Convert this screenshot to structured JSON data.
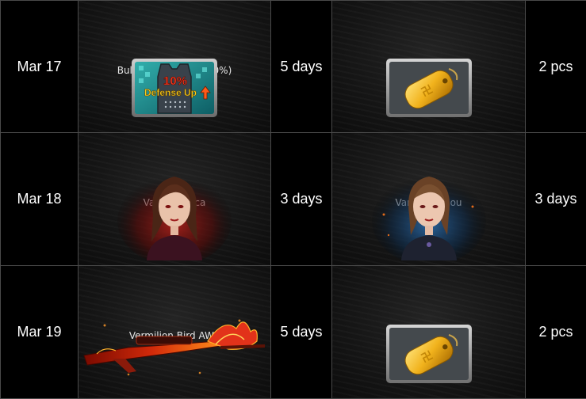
{
  "rows": [
    {
      "date": "Mar 17",
      "left_item": {
        "name": "Bullet Proof Vest+(10%)",
        "icon": "vest-icon",
        "icon_text_top": "10%",
        "icon_text_bottom": "Defense Up"
      },
      "left_duration": "5 days",
      "right_item": {
        "name": "Golden Tag",
        "icon": "golden-tag-icon"
      },
      "right_quantity": "2 pcs"
    },
    {
      "date": "Mar 18",
      "left_item": {
        "name": "Vampire Rica",
        "icon": "character-portrait"
      },
      "left_duration": "3 days",
      "right_item": {
        "name": "Vampire Chou",
        "icon": "character-portrait"
      },
      "right_quantity": "3 days"
    },
    {
      "date": "Mar 19",
      "left_item": {
        "name": "Vermilion Bird AWP",
        "icon": "rifle-icon"
      },
      "left_duration": "5 days",
      "right_item": {
        "name": "Golden Tag",
        "icon": "golden-tag-icon"
      },
      "right_quantity": "2 pcs"
    }
  ],
  "colors": {
    "background": "#000000",
    "border": "#4a4a4a",
    "text": "#ffffff",
    "gold": "#e0a31a",
    "rica_glow": "#b0201a",
    "chou_glow": "#2a6aa8"
  }
}
